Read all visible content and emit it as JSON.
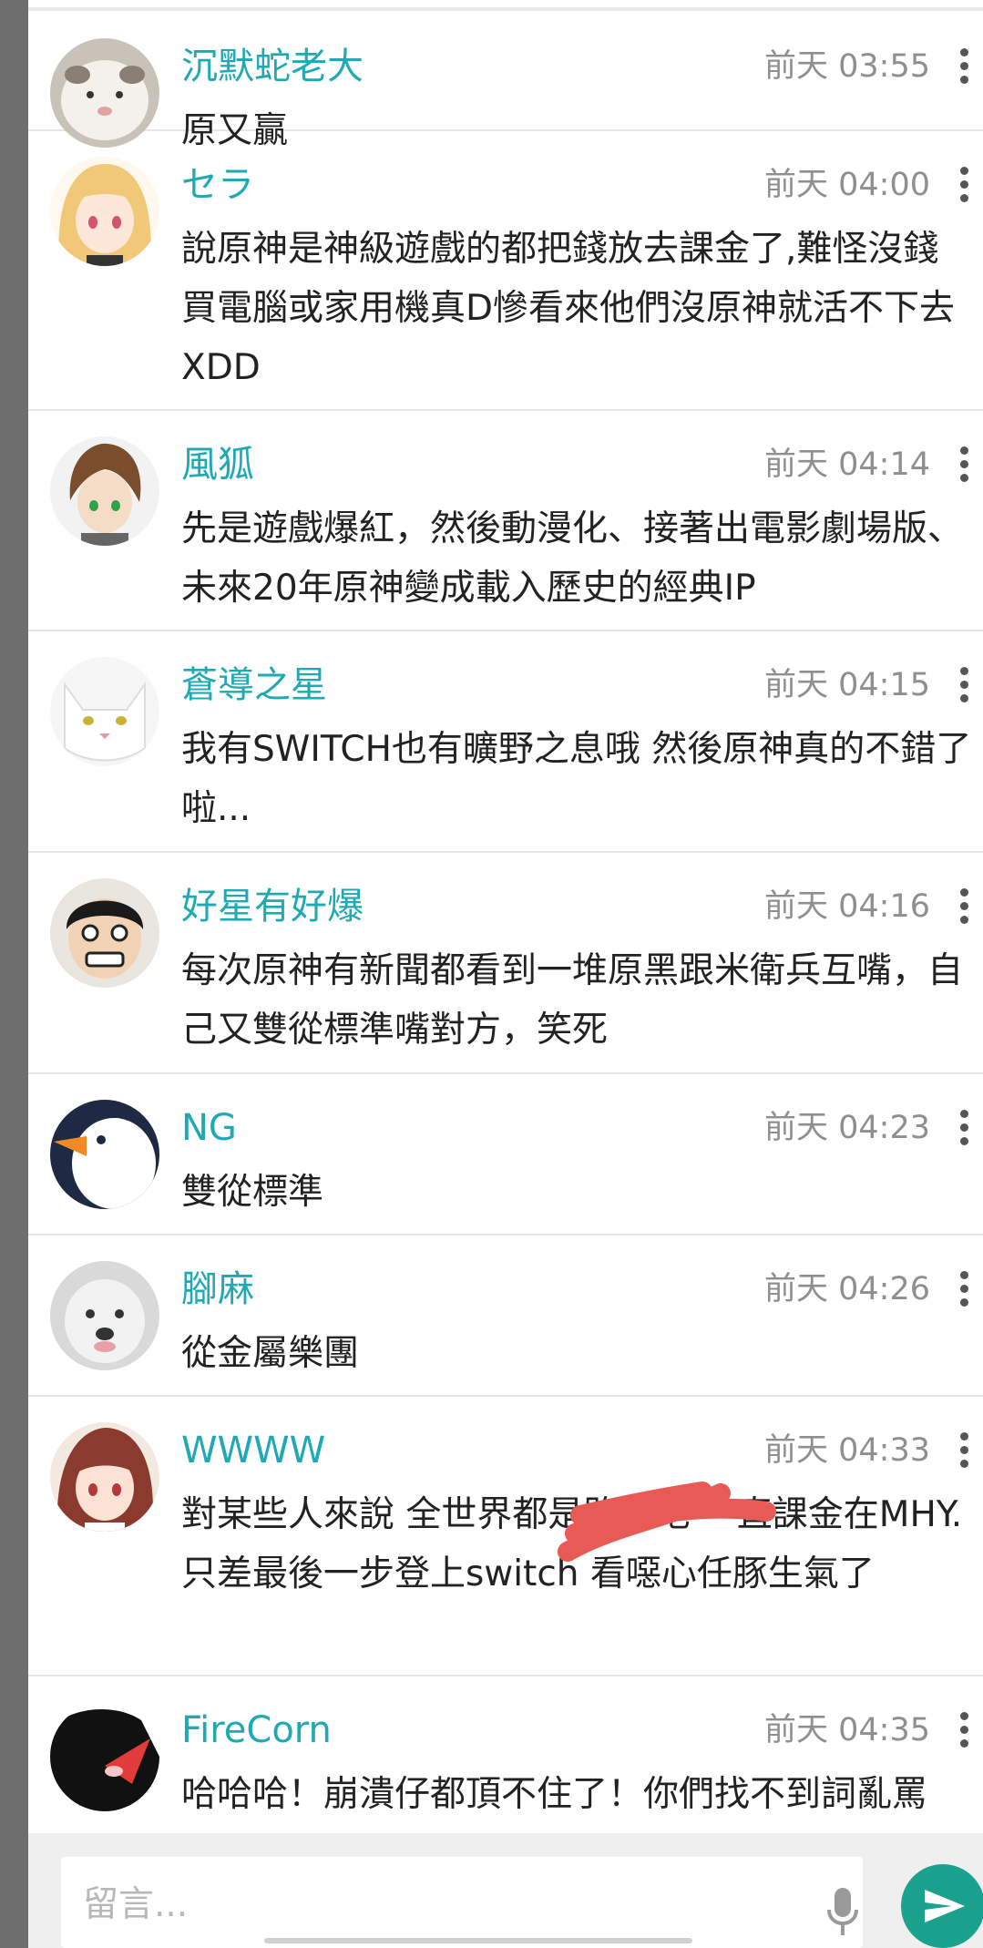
{
  "comments": [
    {
      "name": "沉默蛇老大",
      "time": "前天 03:55",
      "text": "原又贏"
    },
    {
      "name": "セラ",
      "time": "前天 04:00",
      "text": "說原神是神級遊戲的都把錢放去課金了,難怪沒錢買電腦或家用機真D慘看來他們沒原神就活不下去XDD"
    },
    {
      "name": "風狐",
      "time": "前天 04:14",
      "text": "先是遊戲爆紅，然後動漫化、接著出電影劇場版、未來20年原神變成載入歷史的經典IP"
    },
    {
      "name": "蒼導之星",
      "time": "前天 04:15",
      "text": "我有SWITCH也有曠野之息哦  然後原神真的不錯了啦..."
    },
    {
      "name": "好星有好爆",
      "time": "前天 04:16",
      "text": "每次原神有新聞都看到一堆原黑跟米衛兵互嘴，自己又雙從標準嘴對方，笑死"
    },
    {
      "name": "NG",
      "time": "前天 04:23",
      "text": "雙從標準"
    },
    {
      "name": "腳麻",
      "time": "前天 04:26",
      "text": "從金屬樂團"
    },
    {
      "name": "WWWW",
      "time": "前天 04:33",
      "text": "對某些人來說 全世界都是路人吧 一直課金在MHY. 只差最後一步登上switch 看噁心任豚生氣了"
    },
    {
      "name": "FireCorn",
      "time": "前天 04:35",
      "text": "哈哈哈！崩潰仔都頂不住了！你們找不到詞亂罵"
    }
  ],
  "input": {
    "placeholder": "留言..."
  },
  "icons": {
    "more": "more-vert-icon",
    "mic": "microphone-icon",
    "send": "send-icon"
  },
  "colors": {
    "name": "#1fa9b5",
    "time": "#8f8f8f",
    "send": "#1aa28e",
    "redaction": "#e85a55"
  }
}
